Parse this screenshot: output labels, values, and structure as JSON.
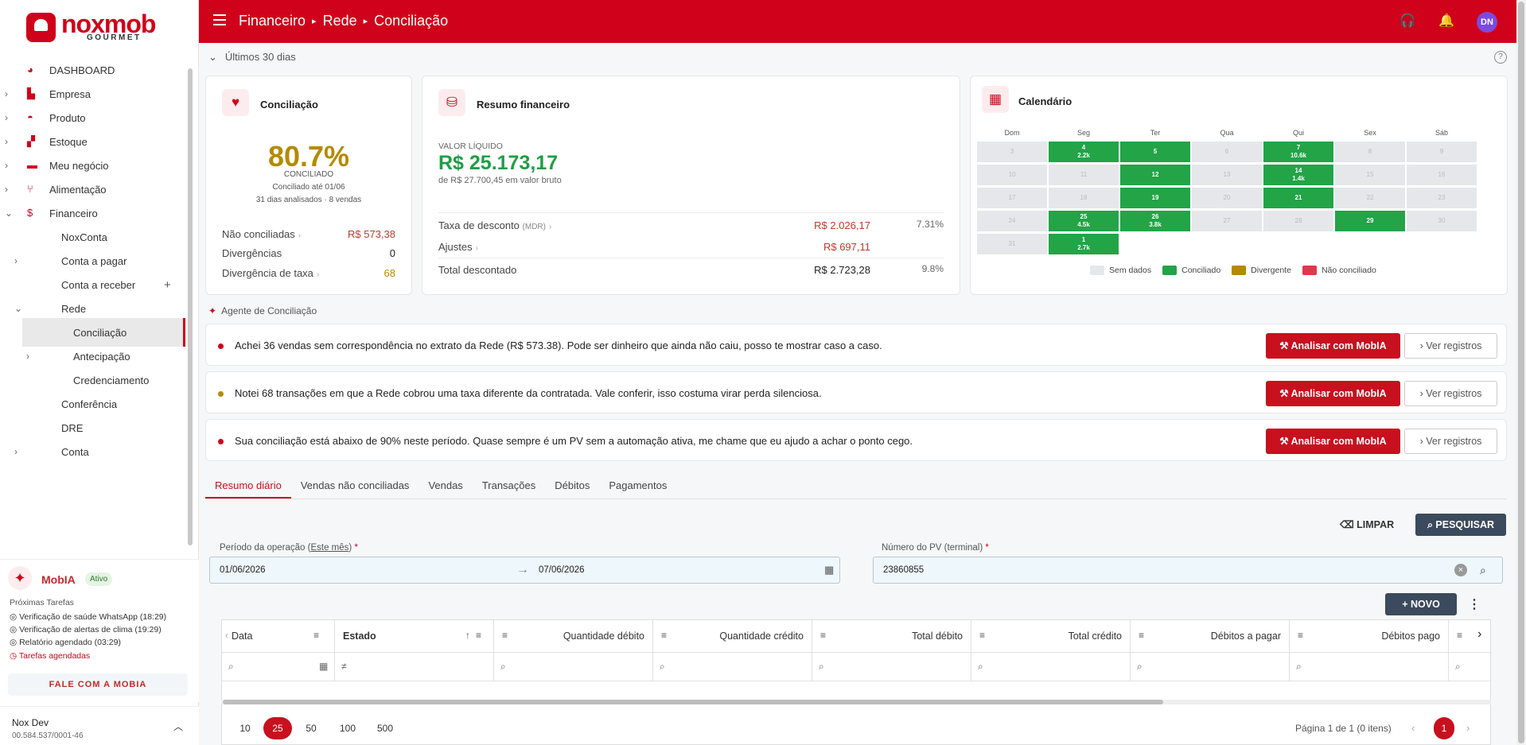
{
  "brand": {
    "name": "noxmob",
    "sub": "GOURMET",
    "accent": "#d0021b"
  },
  "sidebar": {
    "items": [
      {
        "label": "DASHBOARD"
      },
      {
        "label": "Empresa"
      },
      {
        "label": "Produto"
      },
      {
        "label": "Estoque"
      },
      {
        "label": "Meu negócio"
      },
      {
        "label": "Alimentação"
      },
      {
        "label": "Financeiro"
      },
      {
        "label": "NoxConta"
      },
      {
        "label": "Conta a pagar"
      },
      {
        "label": "Conta a receber"
      },
      {
        "label": "Rede"
      },
      {
        "label": "Conciliação"
      },
      {
        "label": "Antecipação"
      },
      {
        "label": "Credenciamento"
      },
      {
        "label": "Conferência"
      },
      {
        "label": "DRE"
      },
      {
        "label": "Conta"
      }
    ],
    "add_symbol": "+"
  },
  "mobia": {
    "title": "MobIA",
    "status": "Ativo",
    "tasks_title": "Próximas Tarefas",
    "tasks": [
      "Verificação de saúde WhatsApp (18:29)",
      "Verificação de alertas de clima (19:29)",
      "Relatório agendado (03:29)"
    ],
    "scheduled": "Tarefas agendadas",
    "contact": "FALE COM A MOBIA"
  },
  "user": {
    "name": "Nox Dev",
    "id": "00.584.537/0001-46",
    "initials": "DN"
  },
  "breadcrumb": {
    "a": "Financeiro",
    "b": "Rede",
    "c": "Conciliação"
  },
  "period": "Últimos 30 dias",
  "conciliacao": {
    "title": "Conciliação",
    "pct": "80.7%",
    "status": "CONCILIADO",
    "until": "Conciliado até 01/06",
    "analysed": "31 dias analisados · 8 vendas",
    "rows": [
      {
        "label": "Não conciliadas",
        "value": "R$ 573,38"
      },
      {
        "label": "Divergências",
        "value": "0"
      },
      {
        "label": "Divergência de taxa",
        "value": "68"
      }
    ]
  },
  "resumo": {
    "title": "Resumo financeiro",
    "label": "VALOR LÍQUIDO",
    "value": "R$ 25.173,17",
    "sub": "de R$ 27.700,45 em valor bruto",
    "rows": [
      {
        "label": "Taxa de desconto",
        "tag": "(MDR)",
        "value": "R$ 2.026,17",
        "pct": "7.31%"
      },
      {
        "label": "Ajustes",
        "value": "R$ 697,11",
        "pct": ""
      },
      {
        "label": "Total descontado",
        "value": "R$ 2.723,28",
        "pct": "9.8%"
      }
    ]
  },
  "calendario": {
    "title": "Calendário",
    "dow": [
      "Dom",
      "Seg",
      "Ter",
      "Qua",
      "Qui",
      "Sex",
      "Sáb"
    ],
    "weeks": [
      [
        {
          "d": "3"
        },
        {
          "d": "4",
          "v": "2.2k",
          "s": "c"
        },
        {
          "d": "5",
          "s": "c"
        },
        {
          "d": "6"
        },
        {
          "d": "7",
          "v": "10.6k",
          "s": "c"
        },
        {
          "d": "8"
        },
        {
          "d": "9"
        }
      ],
      [
        {
          "d": "10"
        },
        {
          "d": "11"
        },
        {
          "d": "12",
          "s": "c"
        },
        {
          "d": "13"
        },
        {
          "d": "14",
          "v": "1.4k",
          "s": "c"
        },
        {
          "d": "15"
        },
        {
          "d": "16"
        }
      ],
      [
        {
          "d": "17"
        },
        {
          "d": "18"
        },
        {
          "d": "19",
          "s": "c"
        },
        {
          "d": "20"
        },
        {
          "d": "21",
          "s": "c"
        },
        {
          "d": "22"
        },
        {
          "d": "23"
        }
      ],
      [
        {
          "d": "24"
        },
        {
          "d": "25",
          "v": "4.5k",
          "s": "c"
        },
        {
          "d": "26",
          "v": "3.8k",
          "s": "c"
        },
        {
          "d": "27"
        },
        {
          "d": "28"
        },
        {
          "d": "29",
          "s": "c"
        },
        {
          "d": "30"
        }
      ],
      [
        {
          "d": "31"
        },
        {
          "d": "1",
          "v": "2.7k",
          "s": "c"
        }
      ]
    ],
    "legend": [
      {
        "label": "Sem dados",
        "color": "#e5e7ea"
      },
      {
        "label": "Conciliado",
        "color": "#22a447"
      },
      {
        "label": "Divergente",
        "color": "#b58a00"
      },
      {
        "label": "Não conciliado",
        "color": "#e0384c"
      }
    ]
  },
  "agent": {
    "title": "Agente de Conciliação",
    "items": [
      {
        "text": "Achei 36 vendas sem correspondência no extrato da Rede (R$ 573.38). Pode ser dinheiro que ainda não caiu, posso te mostrar caso a caso.",
        "dot": "#d0021b"
      },
      {
        "text": "Notei 68 transações em que a Rede cobrou uma taxa diferente da contratada. Vale conferir, isso costuma virar perda silenciosa.",
        "dot": "#b58a00"
      },
      {
        "text": "Sua conciliação está abaixo de 90% neste período. Quase sempre é um PV sem a automação ativa, me chame que eu ajudo a achar o ponto cego.",
        "dot": "#d0021b"
      }
    ],
    "analyse_label": "Analisar com MobIA",
    "records_label": "Ver registros"
  },
  "tabs": [
    "Resumo diário",
    "Vendas não conciliadas",
    "Vendas",
    "Transações",
    "Débitos",
    "Pagamentos"
  ],
  "filters": {
    "clear": "LIMPAR",
    "search": "PESQUISAR",
    "period_label": "Período da operação (",
    "period_link": "Este mês",
    "period_end": ")",
    "start": "01/06/2026",
    "end": "07/06/2026",
    "pv_label": "Número do PV (terminal)",
    "pv": "23860855",
    "required": "*"
  },
  "new_label": "NOVO",
  "table": {
    "columns": [
      "Data",
      "Estado",
      "Quantidade débito",
      "Quantidade crédito",
      "Total débito",
      "Total crédito",
      "Débitos a pagar",
      "Débitos pago"
    ]
  },
  "pagination": {
    "sizes": [
      "10",
      "25",
      "50",
      "100",
      "500"
    ],
    "selected": "25",
    "info": "Página 1 de 1 (0 itens)",
    "current": "1"
  }
}
